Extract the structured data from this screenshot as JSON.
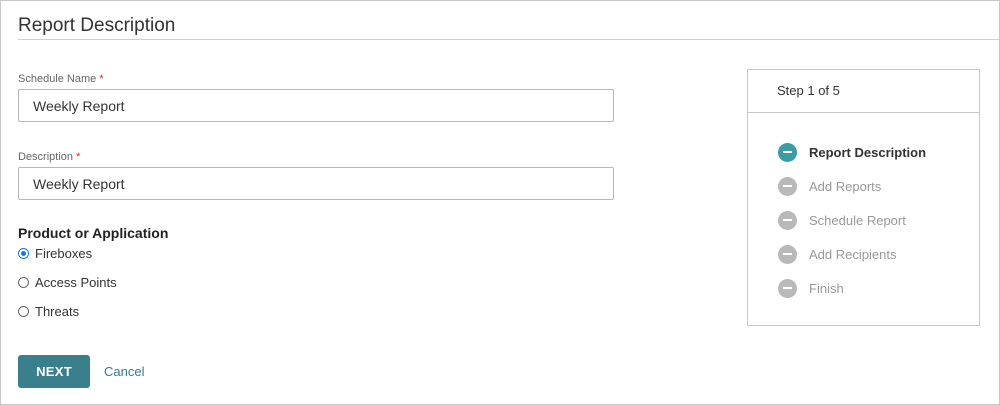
{
  "page": {
    "title": "Report Description"
  },
  "form": {
    "schedule_name": {
      "label": "Schedule Name",
      "required_mark": "*",
      "value": "Weekly Report"
    },
    "description": {
      "label": "Description",
      "required_mark": "*",
      "value": "Weekly Report"
    },
    "product": {
      "label": "Product or Application",
      "options": [
        "Fireboxes",
        "Access Points",
        "Threats"
      ],
      "selected": "Fireboxes"
    }
  },
  "actions": {
    "next_label": "NEXT",
    "cancel_label": "Cancel"
  },
  "steps": {
    "counter": "Step 1 of 5",
    "items": [
      {
        "label": "Report Description",
        "state": "active"
      },
      {
        "label": "Add Reports",
        "state": "pending"
      },
      {
        "label": "Schedule Report",
        "state": "pending"
      },
      {
        "label": "Add Recipients",
        "state": "pending"
      },
      {
        "label": "Finish",
        "state": "pending"
      }
    ]
  },
  "colors": {
    "accent": "#3a7f8c",
    "active_step": "#3a9ca8",
    "inactive_step": "#b9b9b9",
    "required": "#d9282f",
    "radio_selected": "#1a73e8"
  },
  "icons": {
    "step": "minus-circle-icon"
  }
}
